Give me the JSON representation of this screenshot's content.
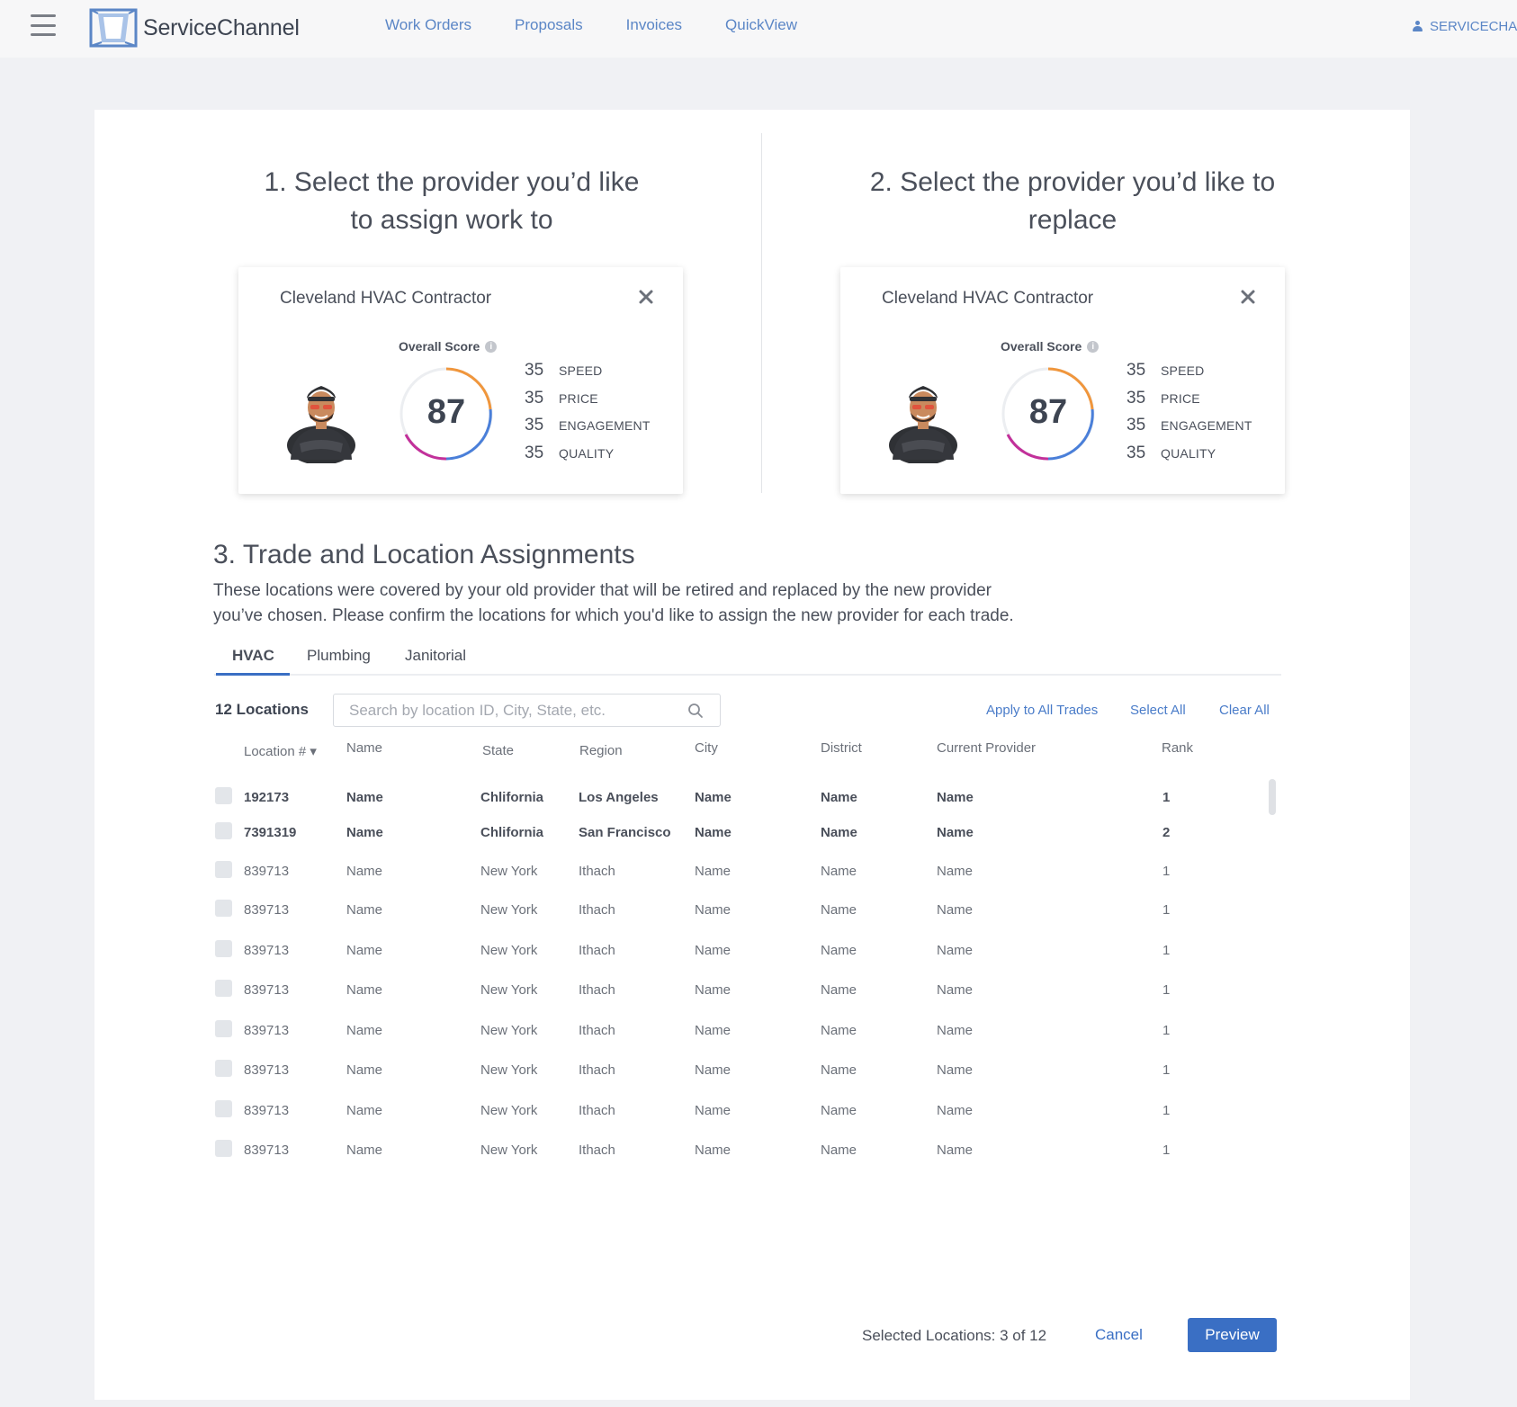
{
  "header": {
    "brand": "ServiceChannel",
    "nav": [
      "Work Orders",
      "Proposals",
      "Invoices",
      "QuickView"
    ],
    "user": "SERVICECHAN"
  },
  "step1": {
    "title_line1": "1. Select the provider you’d like",
    "title_line2": "to assign work to",
    "provider": {
      "name": "Cleveland HVAC Contractor",
      "overall_label": "Overall Score",
      "score": "87",
      "metrics": [
        {
          "value": "35",
          "label": "SPEED"
        },
        {
          "value": "35",
          "label": "PRICE"
        },
        {
          "value": "35",
          "label": "ENGAGEMENT"
        },
        {
          "value": "35",
          "label": "QUALITY"
        }
      ]
    }
  },
  "step2": {
    "title_line1": "2. Select the provider you’d like to",
    "title_line2": "replace",
    "provider": {
      "name": "Cleveland HVAC Contractor",
      "overall_label": "Overall Score",
      "score": "87",
      "metrics": [
        {
          "value": "35",
          "label": "SPEED"
        },
        {
          "value": "35",
          "label": "PRICE"
        },
        {
          "value": "35",
          "label": "ENGAGEMENT"
        },
        {
          "value": "35",
          "label": "QUALITY"
        }
      ]
    }
  },
  "step3": {
    "title": "3. Trade and Location Assignments",
    "desc_line1": "These locations were covered by your old provider that will be retired and replaced by the new provider",
    "desc_line2": "you’ve chosen. Please confirm the locations for which you'd like to assign the new provider for each trade.",
    "tabs": [
      "HVAC",
      "Plumbing",
      "Janitorial"
    ],
    "location_count": "12 Locations",
    "search_placeholder": "Search by location ID, City, State, etc.",
    "actions": {
      "apply_all": "Apply to All Trades",
      "select_all": "Select All",
      "clear_all": "Clear All"
    },
    "columns": [
      "Location # ▾",
      "Name",
      "State",
      "Region",
      "City",
      "District",
      "Current Provider",
      "Rank"
    ],
    "rows": [
      [
        "192173",
        "Name",
        "Chlifornia",
        "Los Angeles",
        "Name",
        "Name",
        "Name",
        "1"
      ],
      [
        "7391319",
        "Name",
        "Chlifornia",
        "San Francisco",
        "Name",
        "Name",
        "Name",
        "2"
      ],
      [
        "839713",
        "Name",
        "New York",
        "Ithach",
        "Name",
        "Name",
        "Name",
        "1"
      ],
      [
        "839713",
        "Name",
        "New York",
        "Ithach",
        "Name",
        "Name",
        "Name",
        "1"
      ],
      [
        "839713",
        "Name",
        "New York",
        "Ithach",
        "Name",
        "Name",
        "Name",
        "1"
      ],
      [
        "839713",
        "Name",
        "New York",
        "Ithach",
        "Name",
        "Name",
        "Name",
        "1"
      ],
      [
        "839713",
        "Name",
        "New York",
        "Ithach",
        "Name",
        "Name",
        "Name",
        "1"
      ],
      [
        "839713",
        "Name",
        "New York",
        "Ithach",
        "Name",
        "Name",
        "Name",
        "1"
      ],
      [
        "839713",
        "Name",
        "New York",
        "Ithach",
        "Name",
        "Name",
        "Name",
        "1"
      ],
      [
        "839713",
        "Name",
        "New York",
        "Ithach",
        "Name",
        "Name",
        "Name",
        "1"
      ]
    ],
    "selected_text": "Selected Locations: 3 of 12",
    "cancel_label": "Cancel",
    "preview_label": "Preview"
  },
  "colors": {
    "accent": "#3a6fc4",
    "link": "#5b86c6",
    "gauge_orange": "#f0963c",
    "gauge_blue": "#4a7fd9",
    "gauge_magenta": "#c2309a"
  }
}
